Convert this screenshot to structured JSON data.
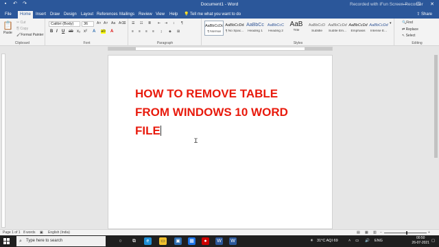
{
  "title_bar": {
    "document_title": "Document1 - Word",
    "watermark": "Recorded with iFun Screen Recorder",
    "qat": {
      "save_icon": "save-icon",
      "undo_icon": "undo-icon",
      "redo_icon": "redo-icon"
    },
    "window_controls": [
      "—",
      "☐",
      "✕"
    ]
  },
  "tabs": {
    "items": [
      "File",
      "Home",
      "Insert",
      "Draw",
      "Design",
      "Layout",
      "References",
      "Mailings",
      "Review",
      "View",
      "Help"
    ],
    "active": "Home",
    "tell_me": "Tell me what you want to do",
    "share": "Share"
  },
  "ribbon": {
    "clipboard": {
      "paste": "Paste",
      "cut": "Cut",
      "copy": "Copy",
      "format_painter": "Format Painter",
      "label": "Clipboard"
    },
    "font": {
      "family": "Calibri (Body)",
      "size": "36",
      "label": "Font"
    },
    "paragraph": {
      "label": "Paragraph"
    },
    "styles": {
      "label": "Styles",
      "items": [
        {
          "sample": "AaBbCcDd",
          "name": "¶ Normal"
        },
        {
          "sample": "AaBbCcDd",
          "name": "¶ No Spac..."
        },
        {
          "sample": "AaBbCc",
          "name": "Heading 1"
        },
        {
          "sample": "AaBbCcC",
          "name": "Heading 2"
        },
        {
          "sample": "AaB",
          "name": "Title"
        },
        {
          "sample": "AaBbCcD",
          "name": "Subtitle"
        },
        {
          "sample": "AaBbCcDd",
          "name": "Subtle Em..."
        },
        {
          "sample": "AaBbCcDd",
          "name": "Emphasis"
        },
        {
          "sample": "AaBbCcDd",
          "name": "Intense E..."
        }
      ]
    },
    "editing": {
      "find": "Find",
      "replace": "Replace",
      "select": "Select",
      "label": "Editing"
    }
  },
  "document": {
    "lines": [
      "HOW TO REMOVE TABLE",
      "FROM WINDOWS 10 WORD",
      "FILE"
    ],
    "text_color": "#e81a0c"
  },
  "status_bar": {
    "page": "Page 1 of 1",
    "words": "8 words",
    "language": "English (India)",
    "zoom": "100%"
  },
  "taskbar": {
    "search_placeholder": "Type here to search",
    "weather": "31°C AQI 69",
    "lang": "ENG",
    "time": "00:50",
    "date": "26-07-2021"
  }
}
